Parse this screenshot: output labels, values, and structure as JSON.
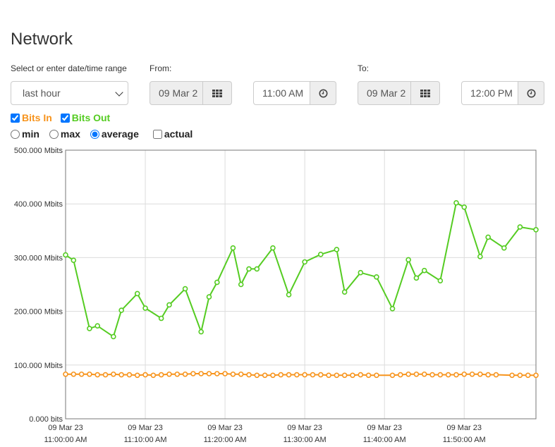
{
  "page": {
    "title": "Network",
    "range_label": "Select or enter date/time range",
    "range_value": "last hour",
    "from_label": "From:",
    "from_date": "09 Mar 2",
    "from_time": "11:00 AM",
    "to_label": "To:",
    "to_date": "09 Mar 2",
    "to_time": "12:00 PM",
    "calendar_icon": "calendar-grid-icon",
    "clock_icon": "clock-icon"
  },
  "series_toggles": [
    {
      "label": "Bits In",
      "checked": true,
      "color": "#f7941d"
    },
    {
      "label": "Bits Out",
      "checked": true,
      "color": "#55cc22"
    }
  ],
  "modes": [
    {
      "label": "min",
      "type": "radio",
      "checked": false
    },
    {
      "label": "max",
      "type": "radio",
      "checked": false
    },
    {
      "label": "average",
      "type": "radio",
      "checked": true
    },
    {
      "label": "actual",
      "type": "checkbox",
      "checked": false
    }
  ],
  "chart_data": {
    "type": "line",
    "ylim": [
      0,
      500
    ],
    "y_ticks": [
      {
        "value": 0,
        "label": "0.000 bits"
      },
      {
        "value": 100,
        "label": "100.000 Mbits"
      },
      {
        "value": 200,
        "label": "200.000 Mbits"
      },
      {
        "value": 300,
        "label": "300.000 Mbits"
      },
      {
        "value": 400,
        "label": "400.000 Mbits"
      },
      {
        "value": 500,
        "label": "500.000 Mbits"
      }
    ],
    "xlim": [
      0,
      59
    ],
    "x_ticks": [
      {
        "value": 0,
        "line1": "09 Mar 23",
        "line2": "11:00:00 AM"
      },
      {
        "value": 10,
        "line1": "09 Mar 23",
        "line2": "11:10:00 AM"
      },
      {
        "value": 20,
        "line1": "09 Mar 23",
        "line2": "11:20:00 AM"
      },
      {
        "value": 30,
        "line1": "09 Mar 23",
        "line2": "11:30:00 AM"
      },
      {
        "value": 40,
        "line1": "09 Mar 23",
        "line2": "11:40:00 AM"
      },
      {
        "value": 50,
        "line1": "09 Mar 23",
        "line2": "11:50:00 AM"
      }
    ],
    "grid": true,
    "series": [
      {
        "name": "Bits Out",
        "color": "#55cc22",
        "x": [
          0,
          1,
          3,
          4,
          6,
          7,
          9,
          10,
          12,
          13,
          15,
          17,
          18,
          19,
          21,
          22,
          23,
          24,
          26,
          28,
          30,
          32,
          34,
          35,
          37,
          39,
          41,
          43,
          44,
          45,
          47,
          49,
          50,
          52,
          53,
          55,
          57,
          59
        ],
        "values": [
          305,
          295,
          168,
          173,
          153,
          202,
          233,
          206,
          187,
          212,
          242,
          162,
          227,
          254,
          318,
          250,
          279,
          279,
          318,
          231,
          292,
          306,
          315,
          236,
          272,
          264,
          205,
          296,
          262,
          276,
          257,
          402,
          394,
          302,
          338,
          318,
          357,
          352
        ]
      },
      {
        "name": "Bits In",
        "color": "#f7941d",
        "x": [
          0,
          1,
          2,
          3,
          4,
          5,
          6,
          7,
          8,
          9,
          10,
          11,
          12,
          13,
          14,
          15,
          16,
          17,
          18,
          19,
          20,
          21,
          22,
          23,
          24,
          25,
          26,
          27,
          28,
          29,
          30,
          31,
          32,
          33,
          34,
          35,
          36,
          37,
          38,
          39,
          41,
          42,
          43,
          44,
          45,
          46,
          47,
          48,
          49,
          50,
          51,
          52,
          53,
          54,
          56,
          57,
          58,
          59
        ],
        "values": [
          83,
          83,
          83,
          83,
          82,
          82,
          83,
          82,
          82,
          81,
          82,
          81,
          82,
          83,
          83,
          83,
          84,
          84,
          84,
          84,
          84,
          83,
          83,
          82,
          81,
          81,
          81,
          82,
          82,
          82,
          82,
          82,
          82,
          81,
          81,
          81,
          81,
          82,
          81,
          81,
          81,
          82,
          83,
          83,
          83,
          82,
          82,
          82,
          82,
          83,
          83,
          83,
          82,
          82,
          81,
          81,
          81,
          81
        ]
      }
    ]
  }
}
